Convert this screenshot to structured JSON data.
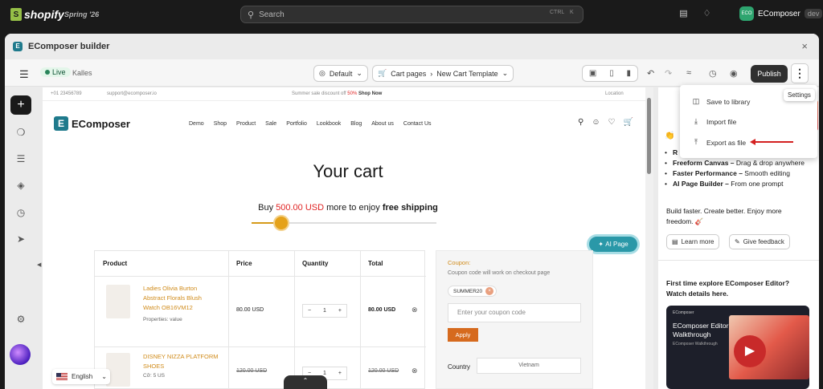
{
  "shopify": {
    "brand": "shopify",
    "edition": "Spring '26",
    "search_placeholder": "Search",
    "shortcut_ctrl": "CTRL",
    "shortcut_k": "K",
    "store_initials": "ECO",
    "store_name": "EComposer",
    "store_tag": "dev"
  },
  "window": {
    "title": "EComposer builder",
    "close": "×"
  },
  "toolbar": {
    "status": "Live",
    "shop": "Kalles",
    "view": "Default",
    "page_type": "Cart pages",
    "template": "New Cart Template",
    "publish": "Publish"
  },
  "canvas": {
    "announcement": {
      "phone": "+01 23456789",
      "email": "support@ecomposer.io",
      "promo_prefix": "Summer sale discount off ",
      "promo_pct": "50%",
      "promo_link": "Shop Now",
      "location": "Location"
    },
    "brand": "EComposer",
    "menu": [
      "Demo",
      "Shop",
      "Product",
      "Sale",
      "Portfolio",
      "Lookbook",
      "Blog",
      "About us",
      "Contact Us"
    ],
    "title": "Your cart",
    "shipping": {
      "pre": "Buy ",
      "amount": "500.00 USD",
      "mid": " more to enjoy ",
      "bold": "free shipping"
    },
    "progress": 0.16,
    "ai_page": "AI Page",
    "table_headers": [
      "Product",
      "Price",
      "Quantity",
      "Total"
    ],
    "rows": [
      {
        "name": "Ladies Olivia Burton Abstract Florals Blush Watch OB16VM12",
        "sub": "Properties: value",
        "price": "80.00 USD",
        "qty": "1",
        "total": "80.00 USD",
        "strike": false
      },
      {
        "name": "DISNEY NIZZA PLATFORM SHOES",
        "sub": "Cỡ: 5 US",
        "price": "120.00 USD",
        "qty": "1",
        "total": "120.00 USD",
        "strike": true
      }
    ],
    "coupon": {
      "heading": "Coupon:",
      "desc": "Coupon code will work on checkout page",
      "code": "SUMMER20",
      "placeholder": "Enter your coupon code",
      "apply": "Apply",
      "country_label": "Country",
      "country": "Vietnam"
    },
    "language": "English"
  },
  "dropdown": {
    "items": [
      "Save to library",
      "Import file",
      "Export as file"
    ],
    "tooltip": "Settings"
  },
  "right_panel": {
    "bullets": [
      {
        "bold": "R",
        "text": ""
      },
      {
        "bold": "Freeform Canvas –",
        "text": " Drag & drop anywhere"
      },
      {
        "bold": "Faster Performance –",
        "text": " Smooth editing"
      },
      {
        "bold": "AI Page Builder –",
        "text": " From one prompt"
      }
    ],
    "tagline": "Build faster. Create better. Enjoy more freedom. 🎸",
    "learn_more": "Learn more",
    "feedback": "Give feedback",
    "explore": "First time explore EComposer Editor? Watch details here.",
    "video_brand": "EComposer",
    "video_title": "EComposer Editor Walkthrough",
    "video_sub": "EComposer Walkthrough"
  }
}
